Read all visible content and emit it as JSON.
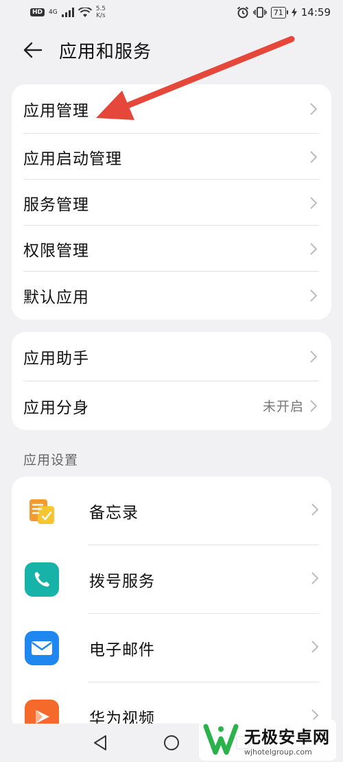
{
  "status_bar": {
    "hd": "HD",
    "network": "4G",
    "speed_value": "5.5",
    "speed_unit": "K/s",
    "battery": "71",
    "time": "14:59"
  },
  "header": {
    "title": "应用和服务"
  },
  "group1": {
    "items": [
      {
        "label": "应用管理"
      },
      {
        "label": "应用启动管理"
      },
      {
        "label": "服务管理"
      },
      {
        "label": "权限管理"
      },
      {
        "label": "默认应用"
      }
    ]
  },
  "group2": {
    "items": [
      {
        "label": "应用助手",
        "value": ""
      },
      {
        "label": "应用分身",
        "value": "未开启"
      }
    ]
  },
  "section_label": "应用设置",
  "apps": {
    "items": [
      {
        "label": "备忘录",
        "icon": "notepad-icon",
        "color": "#f39a2e"
      },
      {
        "label": "拨号服务",
        "icon": "phone-icon",
        "color": "#17b3a8"
      },
      {
        "label": "电子邮件",
        "icon": "mail-icon",
        "color": "#1e88f0"
      },
      {
        "label": "华为视频",
        "icon": "video-icon",
        "color": "#f56a2a"
      }
    ]
  },
  "annotation": {
    "color": "#e5483a"
  },
  "watermark": {
    "title": "无极安卓网",
    "url": "wjhotelgroup.com"
  }
}
